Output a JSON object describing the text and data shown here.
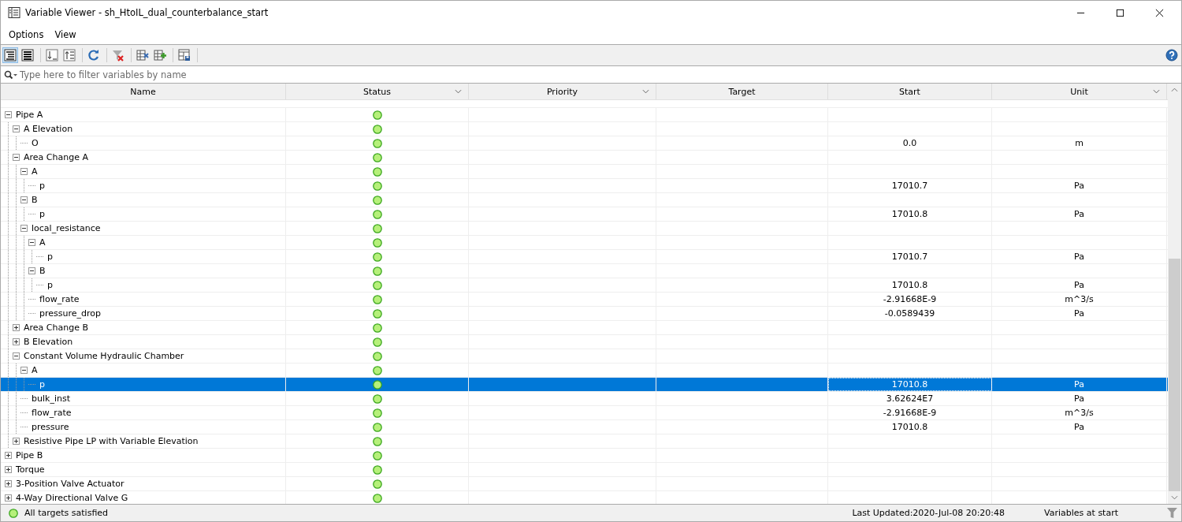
{
  "window": {
    "title": "Variable Viewer - sh_HtoIL_dual_counterbalance_start"
  },
  "menu": [
    "Options",
    "View"
  ],
  "toolbar": [
    {
      "kind": "tree-view",
      "selected": true
    },
    {
      "kind": "flat-view",
      "selected": false
    },
    {
      "kind": "sep"
    },
    {
      "kind": "sort-down",
      "selected": false
    },
    {
      "kind": "sort-up",
      "selected": false
    },
    {
      "kind": "sep"
    },
    {
      "kind": "refresh",
      "selected": false
    },
    {
      "kind": "sep"
    },
    {
      "kind": "clear-filter",
      "selected": false
    },
    {
      "kind": "sep"
    },
    {
      "kind": "remove-column",
      "selected": false
    },
    {
      "kind": "add-column",
      "selected": false
    },
    {
      "kind": "sep"
    },
    {
      "kind": "save-layout",
      "selected": false
    },
    {
      "kind": "sep"
    }
  ],
  "search": {
    "placeholder": "Type here to filter variables by name"
  },
  "columns": [
    {
      "label": "Name",
      "dropdown": false
    },
    {
      "label": "Status",
      "dropdown": true
    },
    {
      "label": "Priority",
      "dropdown": true
    },
    {
      "label": "Target",
      "dropdown": false
    },
    {
      "label": "Start",
      "dropdown": false
    },
    {
      "label": "Unit",
      "dropdown": true
    }
  ],
  "tree": [
    {
      "name": "Pipe A",
      "satisfied": true,
      "expanded": true,
      "selected": false,
      "children": [
        {
          "name": "A Elevation",
          "satisfied": true,
          "expanded": true,
          "selected": false,
          "children": [
            {
              "name": "O",
              "satisfied": true,
              "start": "0.0",
              "unit": "m",
              "selected": false
            }
          ]
        },
        {
          "name": "Area Change A",
          "satisfied": true,
          "expanded": true,
          "selected": false,
          "children": [
            {
              "name": "A",
              "satisfied": true,
              "expanded": true,
              "selected": false,
              "children": [
                {
                  "name": "p",
                  "satisfied": true,
                  "start": "17010.7",
                  "unit": "Pa",
                  "selected": false
                }
              ]
            },
            {
              "name": "B",
              "satisfied": true,
              "expanded": true,
              "selected": false,
              "children": [
                {
                  "name": "p",
                  "satisfied": true,
                  "start": "17010.8",
                  "unit": "Pa",
                  "selected": false
                }
              ]
            },
            {
              "name": "local_resistance",
              "satisfied": true,
              "expanded": true,
              "selected": false,
              "children": [
                {
                  "name": "A",
                  "satisfied": true,
                  "expanded": true,
                  "selected": false,
                  "children": [
                    {
                      "name": "p",
                      "satisfied": true,
                      "start": "17010.7",
                      "unit": "Pa",
                      "selected": false
                    }
                  ]
                },
                {
                  "name": "B",
                  "satisfied": true,
                  "expanded": true,
                  "selected": false,
                  "children": [
                    {
                      "name": "p",
                      "satisfied": true,
                      "start": "17010.8",
                      "unit": "Pa",
                      "selected": false
                    }
                  ]
                },
                {
                  "name": "flow_rate",
                  "satisfied": true,
                  "start": "-2.91668E-9",
                  "unit": "m^3/s",
                  "selected": false
                },
                {
                  "name": "pressure_drop",
                  "satisfied": true,
                  "start": "-0.0589439",
                  "unit": "Pa",
                  "selected": false
                }
              ]
            }
          ]
        },
        {
          "name": "Area Change B",
          "satisfied": true,
          "expanded": false,
          "selected": false
        },
        {
          "name": "B Elevation",
          "satisfied": true,
          "expanded": false,
          "selected": false
        },
        {
          "name": "Constant Volume Hydraulic Chamber",
          "satisfied": true,
          "expanded": true,
          "selected": false,
          "children": [
            {
              "name": "A",
              "satisfied": true,
              "expanded": true,
              "selected": false,
              "children": [
                {
                  "name": "p",
                  "satisfied": true,
                  "start": "17010.8",
                  "unit": "Pa",
                  "selected": true
                }
              ]
            },
            {
              "name": "bulk_inst",
              "satisfied": true,
              "start": "3.62624E7",
              "unit": "Pa",
              "selected": false
            },
            {
              "name": "flow_rate",
              "satisfied": true,
              "start": "-2.91668E-9",
              "unit": "m^3/s",
              "selected": false
            },
            {
              "name": "pressure",
              "satisfied": true,
              "start": "17010.8",
              "unit": "Pa",
              "selected": false
            }
          ]
        },
        {
          "name": "Resistive Pipe LP with Variable Elevation",
          "satisfied": true,
          "expanded": false,
          "selected": false
        }
      ]
    },
    {
      "name": "Pipe B",
      "satisfied": true,
      "expanded": false,
      "selected": false
    },
    {
      "name": "Torque",
      "satisfied": true,
      "expanded": false,
      "selected": false
    },
    {
      "name": "3-Position Valve Actuator",
      "satisfied": true,
      "expanded": false,
      "selected": false
    },
    {
      "name": "4-Way Directional Valve G",
      "satisfied": true,
      "expanded": false,
      "selected": false
    }
  ],
  "status_bar": {
    "satisfied": true,
    "message": "All targets satisfied",
    "last_updated": "Last Updated:2020-Jul-08 20:20:48",
    "mode": "Variables at start"
  }
}
